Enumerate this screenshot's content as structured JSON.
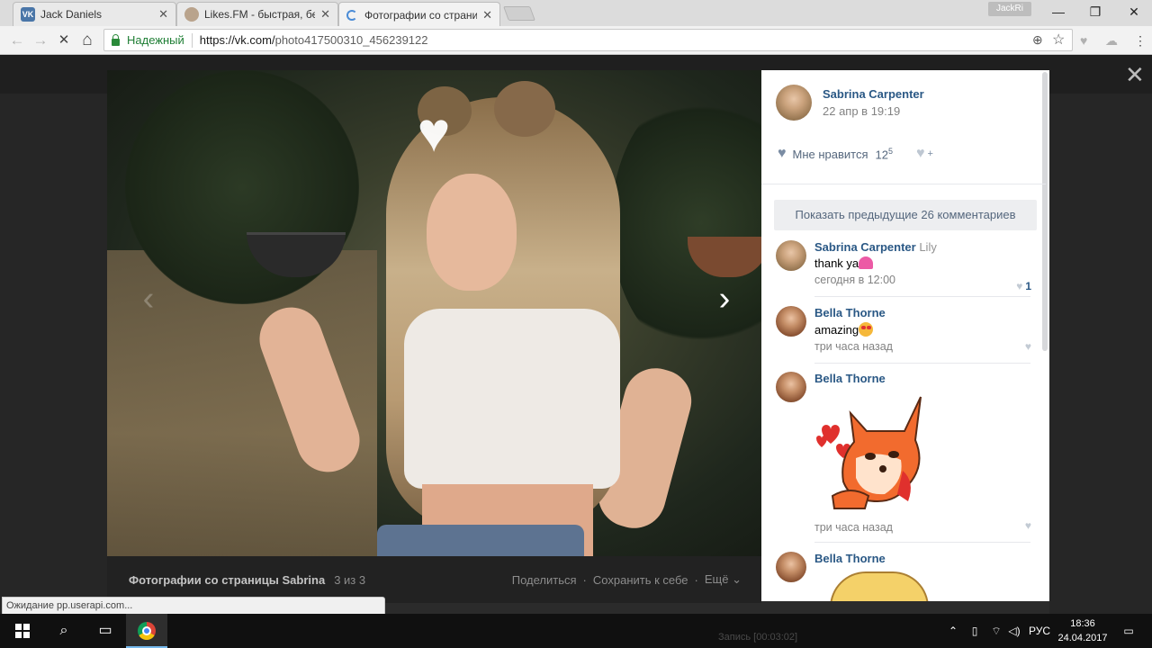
{
  "browser": {
    "tabs": [
      {
        "title": "Jack Daniels",
        "favicon": "vk-favicon",
        "active": false
      },
      {
        "title": "Likes.FM - быстрая, бесп",
        "favicon": "likesfm-favicon",
        "active": false
      },
      {
        "title": "Фотографии со страниц",
        "favicon": "loading-spinner",
        "active": true
      }
    ],
    "profile_badge": "JackRi",
    "window_controls": {
      "minimize": "—",
      "maximize": "❐",
      "close": "✕"
    },
    "nav": {
      "back": "←",
      "forward": "→",
      "stop": "✕",
      "home": "⌂"
    },
    "omnibox": {
      "security_label": "Надежный",
      "url_scheme_host": "https://vk.com/",
      "url_path": "photo417500310_456239122"
    },
    "omnibox_icons": {
      "zoom": "⊕",
      "star": "☆"
    },
    "extension_icons": [
      "♥",
      "☁",
      "⋮"
    ],
    "status_text": "Ожидание pp.userapi.com..."
  },
  "viewer": {
    "close_glyph": "✕",
    "prev_glyph": "‹",
    "next_glyph": "›",
    "filter_heart_glyph": "♥",
    "album_title": "Фотографии со страницы Sabrina",
    "counter": "3 из 3",
    "actions": {
      "share": "Поделиться",
      "save": "Сохранить к себе",
      "more": "Ещё"
    },
    "dot": "·"
  },
  "post": {
    "author": "Sabrina Carpenter",
    "date": "22 апр в 19:19",
    "like_label": "Мне нравится",
    "like_count_base": "12",
    "like_count_sup": "5",
    "share_plus": "+",
    "show_previous": "Показать предыдущие 26 комментариев"
  },
  "comments": [
    {
      "author": "Sabrina Carpenter",
      "reply_to": "Lily",
      "text": "thank ya",
      "time": "сегодня в 12:00",
      "likes": "1"
    },
    {
      "author": "Bella Thorne",
      "reply_to": "",
      "text": "amazing",
      "time": "три часа назад",
      "likes": ""
    },
    {
      "author": "Bella Thorne",
      "reply_to": "",
      "text": "",
      "time": "три часа назад",
      "likes": ""
    },
    {
      "author": "Bella Thorne",
      "reply_to": "",
      "text": "",
      "time": "",
      "likes": ""
    }
  ],
  "taskbar": {
    "rec_text": "Запись [00:03:02]",
    "language": "РУС",
    "time": "18:36",
    "date": "24.04.2017"
  },
  "colors": {
    "vk_link": "#2a5885",
    "secure_green": "#1e7e34",
    "taskbar": "#101010"
  }
}
